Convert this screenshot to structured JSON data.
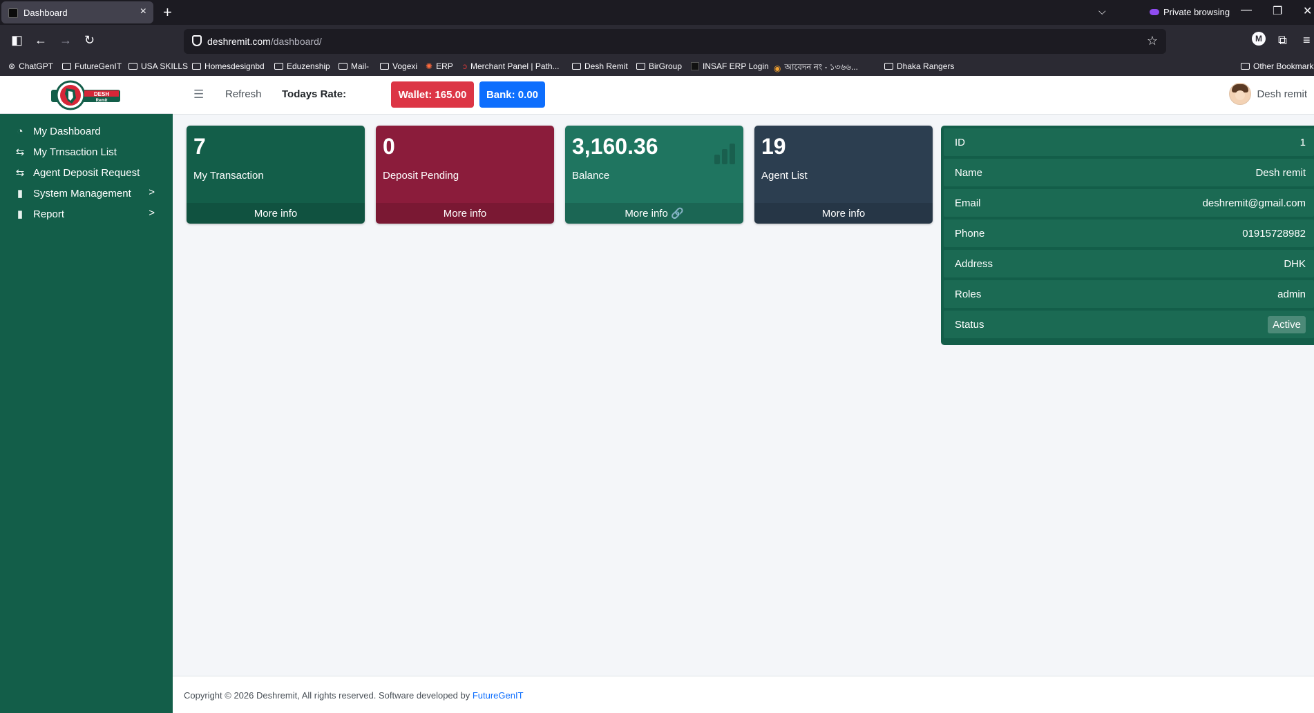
{
  "browser": {
    "tab_title": "Dashboard",
    "url_host": "deshremit.com",
    "url_path": "/dashboard/",
    "private_label": "Private browsing",
    "bookmarks": [
      "ChatGPT",
      "FutureGenIT",
      "USA SKILLS",
      "Homesdesignbd",
      "Eduzenship",
      "Mail-",
      "Vogexi",
      "ERP",
      "Merchant Panel | Path...",
      "Desh Remit",
      "BirGroup",
      "INSAF ERP Login",
      "আবেদন নং - ১৩৬৬...",
      "Dhaka Rangers",
      "Other Bookmarks"
    ]
  },
  "logo": {
    "line1": "DESH",
    "line2": "Remit"
  },
  "sidebar": {
    "items": [
      {
        "label": "My Dashboard",
        "icon": "dashboard-icon"
      },
      {
        "label": "My Trnsaction List",
        "icon": "transfer-icon"
      },
      {
        "label": "Agent Deposit Request",
        "icon": "transfer-icon"
      },
      {
        "label": "System Management",
        "icon": "clipboard-icon",
        "has_submenu": true
      },
      {
        "label": "Report",
        "icon": "clipboard-icon",
        "has_submenu": true
      }
    ]
  },
  "topbar": {
    "refresh": "Refresh",
    "rate_label": "Todays Rate:",
    "wallet": "Wallet: 165.00",
    "bank": "Bank: 0.00",
    "user_name": "Desh remit"
  },
  "cards": [
    {
      "value": "7",
      "label": "My Transaction",
      "link": "More info",
      "color": "#135e49"
    },
    {
      "value": "0",
      "label": "Deposit Pending",
      "link": "More info",
      "color": "#8b1c3b"
    },
    {
      "value": "3,160.36",
      "label": "Balance",
      "link": "More info 🔗",
      "color": "#1f7560"
    },
    {
      "value": "19",
      "label": "Agent List",
      "link": "More info",
      "color": "#2c3e50"
    }
  ],
  "profile": [
    {
      "key": "ID",
      "value": "1"
    },
    {
      "key": "Name",
      "value": "Desh remit"
    },
    {
      "key": "Email",
      "value": "deshremit@gmail.com"
    },
    {
      "key": "Phone",
      "value": "01915728982"
    },
    {
      "key": "Address",
      "value": "DHK"
    },
    {
      "key": "Roles",
      "value": "admin"
    },
    {
      "key": "Status",
      "value": "Active"
    }
  ],
  "footer": {
    "text": "Copyright © 2026 Deshremit, All rights reserved. Software developed by ",
    "link": "FutureGenIT"
  }
}
